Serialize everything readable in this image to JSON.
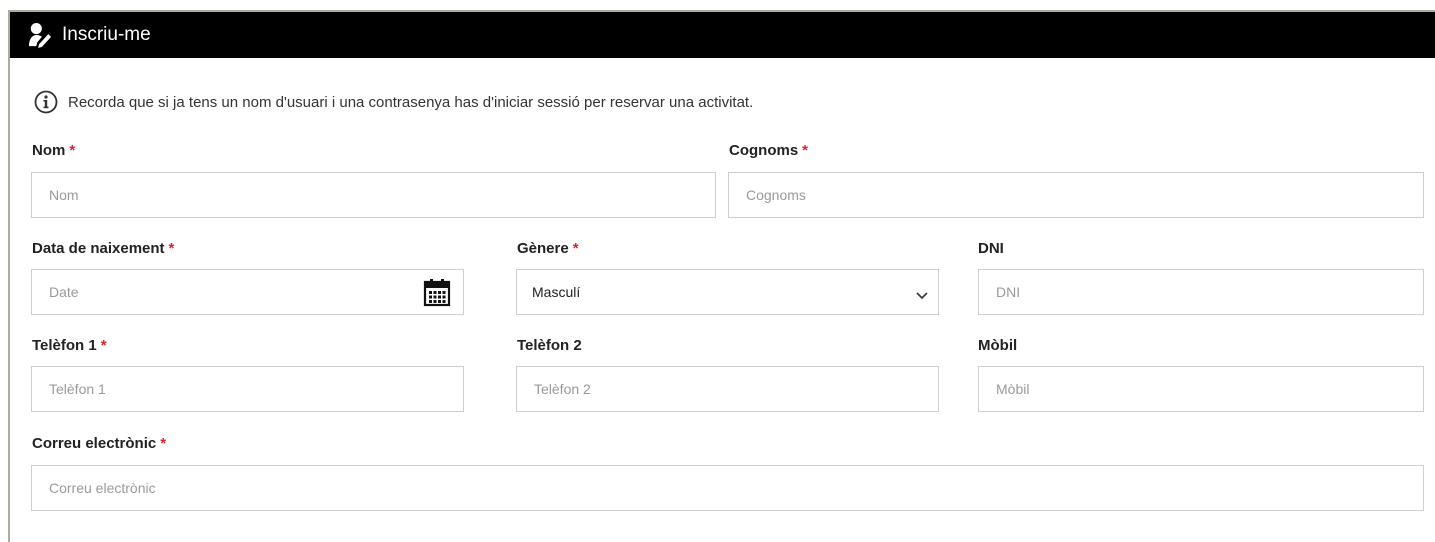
{
  "header": {
    "title": "Inscriu-me",
    "icon": "user-edit-icon"
  },
  "info": {
    "icon": "info-circle-icon",
    "text": "Recorda que si ja tens un nom d'usuari i una contrasenya has d'iniciar sessió per reservar una activitat."
  },
  "required_mark": "*",
  "required_color": "#d9232e",
  "fields": {
    "nom": {
      "label": "Nom",
      "placeholder": "Nom"
    },
    "cognoms": {
      "label": "Cognoms",
      "placeholder": "Cognoms"
    },
    "data": {
      "label": "Data de naixement",
      "placeholder": "Date",
      "icon": "calendar-icon"
    },
    "genere": {
      "label": "Gènere",
      "value": "Masculí",
      "icon": "chevron-down-icon"
    },
    "dni": {
      "label": "DNI",
      "placeholder": "DNI"
    },
    "telefon1": {
      "label": "Telèfon 1",
      "placeholder": "Telèfon 1"
    },
    "telefon2": {
      "label": "Telèfon 2",
      "placeholder": "Telèfon 2"
    },
    "mobil": {
      "label": "Mòbil",
      "placeholder": "Mòbil"
    },
    "correu": {
      "label": "Correu electrònic",
      "placeholder": "Correu electrònic"
    }
  }
}
